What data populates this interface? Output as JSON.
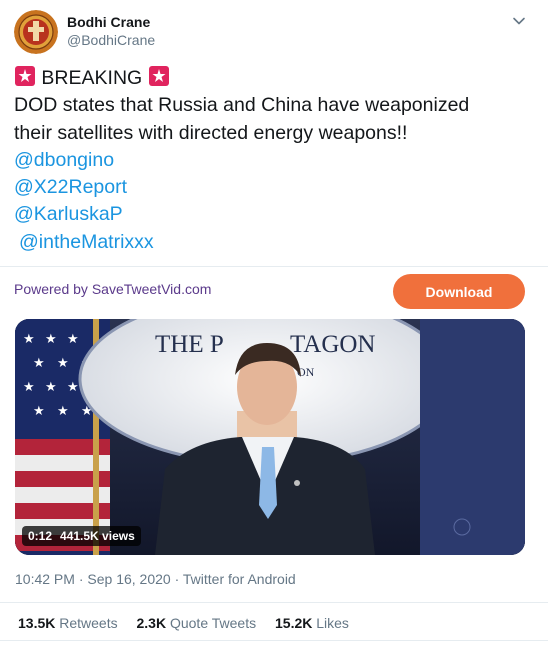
{
  "author": {
    "name": "Bodhi Crane",
    "handle": "@BodhiCrane"
  },
  "tweet": {
    "headline": "BREAKING",
    "line1": "DOD states that Russia and China have weaponized",
    "line2": "their satellites with directed energy weapons!!",
    "mentions": [
      "@dbongino",
      "@X22Report",
      "@KarluskaP",
      "@intheMatrixxx"
    ],
    "siren_icon": "police-car-light-icon"
  },
  "promo": {
    "powered_by": "Powered by SaveTweetVid.com",
    "download_label": "Download",
    "download_color": "#f0703c"
  },
  "video": {
    "duration": "0:12",
    "views": "441.5K views",
    "podium_text_top": "THE PENTAGON",
    "podium_text_visible_left": "THE P",
    "podium_text_visible_right": "TAGON",
    "podium_text_bottom": "ON"
  },
  "meta": {
    "time": "10:42 PM",
    "date": "Sep 16, 2020",
    "client": "Twitter for Android",
    "separator": "·"
  },
  "stats": {
    "retweets_count": "13.5K",
    "retweets_label": "Retweets",
    "quotes_count": "2.3K",
    "quotes_label": "Quote Tweets",
    "likes_count": "15.2K",
    "likes_label": "Likes"
  },
  "colors": {
    "link": "#1b95e0",
    "secondary_text": "#657786",
    "powered_text": "#5b3a8b"
  }
}
